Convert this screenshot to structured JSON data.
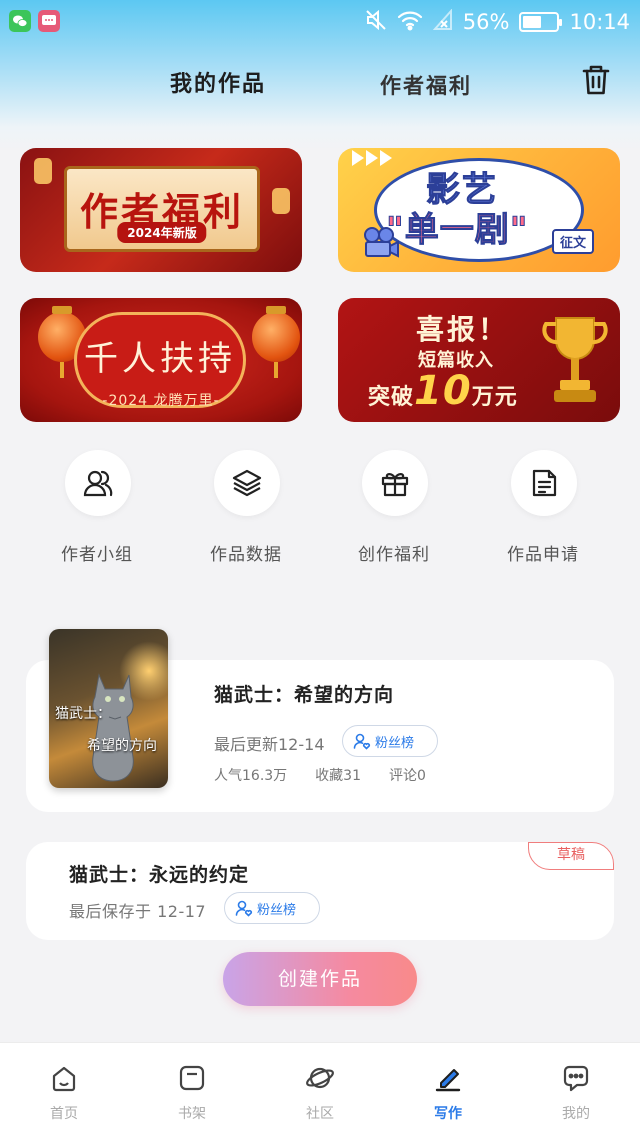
{
  "status_bar": {
    "battery_percent_text": "56%",
    "battery_level": 0.56,
    "time": "10:14",
    "icons": [
      "wechat-icon",
      "message-icon",
      "mute-icon",
      "wifi-icon",
      "no-signal-icon",
      "battery-icon"
    ]
  },
  "header": {
    "tabs": [
      {
        "label": "我的作品",
        "active": true
      },
      {
        "label": "作者福利",
        "active": false
      }
    ],
    "trash_icon": "trash-icon"
  },
  "banners": [
    {
      "title": "作者福利",
      "tag": "2024年新版"
    },
    {
      "line1": "影艺",
      "line2": "\"单一剧\"",
      "tag": "征文"
    },
    {
      "title": "千人扶持",
      "subtitle": "-2024 龙腾万里-"
    },
    {
      "title": "喜报！",
      "subtitle": "短篇收入",
      "highlight_prefix": "突破",
      "highlight_number": "10",
      "highlight_suffix": "万元"
    }
  ],
  "quick_entries": [
    {
      "label": "作者小组",
      "icon": "users-icon"
    },
    {
      "label": "作品数据",
      "icon": "layers-icon"
    },
    {
      "label": "创作福利",
      "icon": "gift-icon"
    },
    {
      "label": "作品申请",
      "icon": "document-icon"
    }
  ],
  "published_work": {
    "cover_text_1": "猫武士：",
    "cover_text_2": "希望的方向",
    "title": "猫武士：希望的方向",
    "last_updated": "最后更新12-14",
    "fans_button": "粉丝榜",
    "stats": {
      "popularity": "人气16.3万",
      "favorites": "收藏31",
      "comments": "评论0"
    }
  },
  "draft_work": {
    "tag": "草稿",
    "title": "猫武士：永远的约定",
    "last_saved": "最后保存于 12-17",
    "fans_button": "粉丝榜"
  },
  "create_button": "创建作品",
  "accent_color": "#2b7be8",
  "bottom_nav": [
    {
      "label": "首页",
      "icon": "home-icon",
      "active": false
    },
    {
      "label": "书架",
      "icon": "bookshelf-icon",
      "active": false
    },
    {
      "label": "社区",
      "icon": "planet-icon",
      "active": false
    },
    {
      "label": "写作",
      "icon": "pen-icon",
      "active": true
    },
    {
      "label": "我的",
      "icon": "chat-bubble-icon",
      "active": false
    }
  ]
}
